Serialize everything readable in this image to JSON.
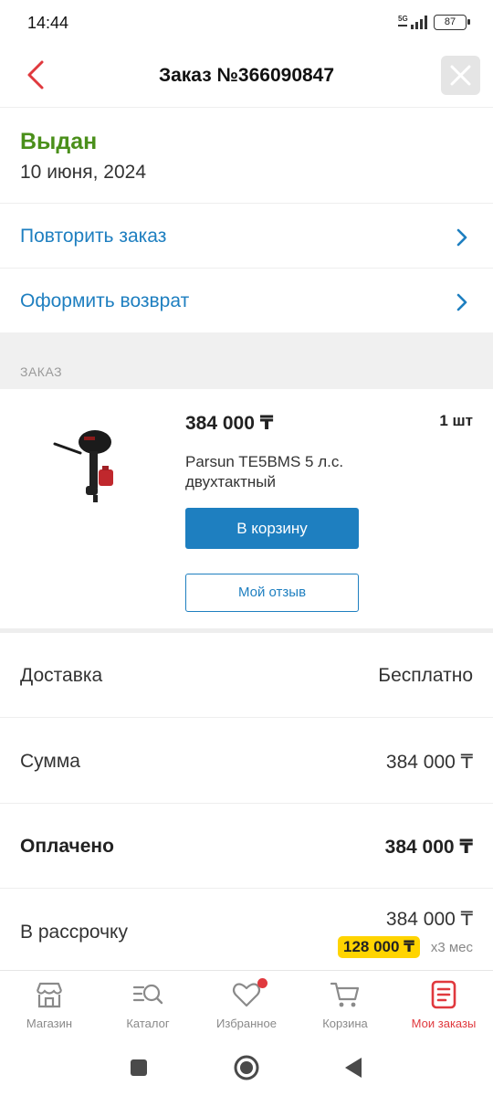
{
  "statusbar": {
    "time": "14:44",
    "network": "5G",
    "battery": "87"
  },
  "header": {
    "title": "Заказ №366090847",
    "back_icon": "chevron-left-icon",
    "close_icon": "close-icon"
  },
  "order_status": {
    "status": "Выдан",
    "date": "10 июня, 2024",
    "status_color": "#4a8f1a"
  },
  "actions": [
    {
      "label": "Повторить заказ"
    },
    {
      "label": "Оформить возврат"
    }
  ],
  "section": {
    "label": "ЗАКАЗ"
  },
  "product": {
    "price": "384 000 ₸",
    "quantity": "1 шт",
    "name": "Parsun TE5BMS 5 л.с. двухтактный",
    "cart_button": "В корзину",
    "review_button": "Мой отзыв"
  },
  "summary": {
    "delivery_label": "Доставка",
    "delivery_value": "Бесплатно",
    "sum_label": "Сумма",
    "sum_value": "384 000 ₸",
    "paid_label": "Оплачено",
    "paid_value": "384 000 ₸",
    "installment_label": "В рассрочку",
    "installment_value": "384 000 ₸",
    "installment_monthly": "128 000 ₸",
    "installment_term": "x3 мес"
  },
  "tabbar": [
    {
      "label": "Магазин",
      "icon": "shop-icon"
    },
    {
      "label": "Каталог",
      "icon": "catalog-search-icon"
    },
    {
      "label": "Избранное",
      "icon": "heart-icon"
    },
    {
      "label": "Корзина",
      "icon": "cart-icon"
    },
    {
      "label": "Мои заказы",
      "icon": "orders-icon",
      "active": true
    }
  ],
  "colors": {
    "accent_blue": "#1e7fc0",
    "accent_red": "#e0393e",
    "status_green": "#4a8f1a",
    "installment_yellow": "#ffd400"
  }
}
